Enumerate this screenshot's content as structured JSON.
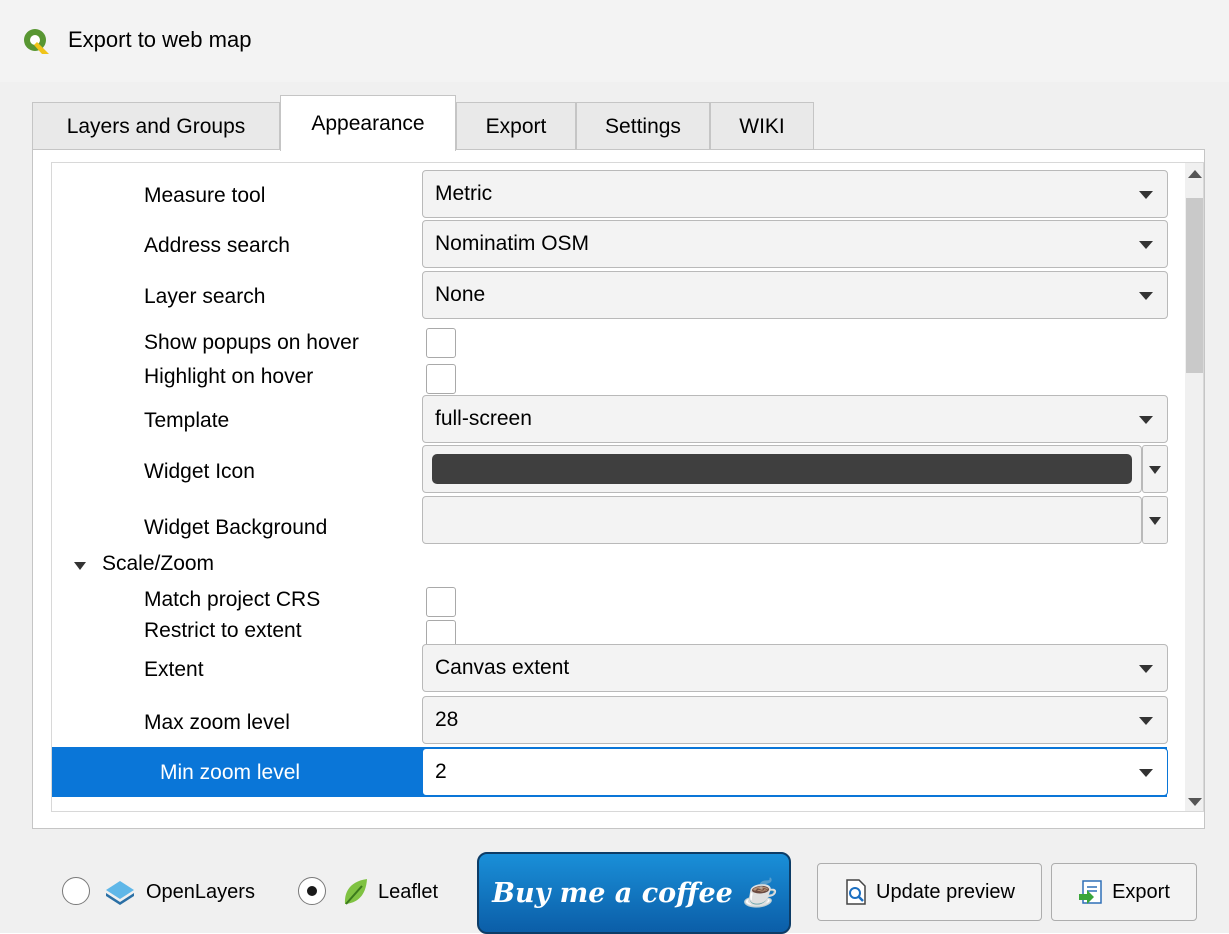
{
  "window": {
    "title": "Export to web map"
  },
  "tabs": [
    {
      "label": "Layers and Groups",
      "active": false
    },
    {
      "label": "Appearance",
      "active": true
    },
    {
      "label": "Export",
      "active": false
    },
    {
      "label": "Settings",
      "active": false
    },
    {
      "label": "WIKI",
      "active": false
    }
  ],
  "appearance": {
    "measure_tool": {
      "label": "Measure tool",
      "value": "Metric"
    },
    "address_search": {
      "label": "Address search",
      "value": "Nominatim OSM"
    },
    "layer_search": {
      "label": "Layer search",
      "value": "None"
    },
    "show_popups_on_hover": {
      "label": "Show popups on hover",
      "checked": false
    },
    "highlight_on_hover": {
      "label": "Highlight on hover",
      "checked": false
    },
    "template": {
      "label": "Template",
      "value": "full-screen"
    },
    "widget_icon": {
      "label": "Widget Icon",
      "color": "#3f3f3f"
    },
    "widget_background": {
      "label": "Widget Background",
      "color": "#f3f3f3"
    },
    "scale_zoom_group": {
      "label": "Scale/Zoom",
      "expanded": true
    },
    "match_project_crs": {
      "label": "Match project CRS",
      "checked": false
    },
    "restrict_to_extent": {
      "label": "Restrict to extent",
      "checked": false
    },
    "extent": {
      "label": "Extent",
      "value": "Canvas extent"
    },
    "max_zoom": {
      "label": "Max zoom level",
      "value": "28"
    },
    "min_zoom": {
      "label": "Min zoom level",
      "value": "2",
      "selected": true
    }
  },
  "footer": {
    "openlayers": {
      "label": "OpenLayers",
      "selected": false
    },
    "leaflet": {
      "label": "Leaflet",
      "selected": true
    },
    "coffee_label": "Buy me a coffee ☕",
    "update_preview_label": "Update preview",
    "export_label": "Export"
  },
  "colors": {
    "selection": "#0a76d8",
    "qgis_green": "#589632",
    "qgis_yellow": "#ee7913"
  }
}
